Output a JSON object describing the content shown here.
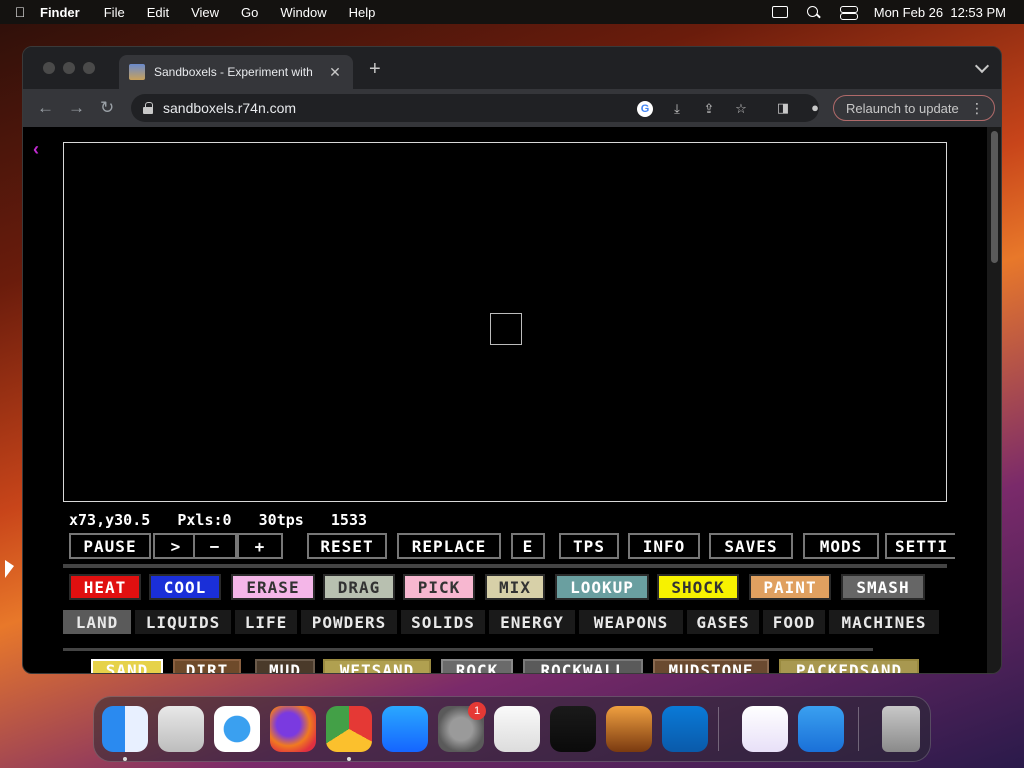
{
  "menubar": {
    "apple": "",
    "items": [
      "Finder",
      "File",
      "Edit",
      "View",
      "Go",
      "Window",
      "Help"
    ],
    "clock": "Mon Feb 26  12:53 PM"
  },
  "browser": {
    "tab_title": "Sandboxels - Experiment with",
    "url": "sandboxels.r74n.com",
    "relaunch": "Relaunch to update"
  },
  "game": {
    "stats": "x73,y30.5   Pxls:0   30tps   1533",
    "toolbar": [
      "Pause",
      ">",
      "−",
      "+",
      "Reset",
      "Replace",
      "E",
      "Tps",
      "Info",
      "Saves",
      "Mods",
      "Setti"
    ],
    "tools": [
      {
        "label": "Heat",
        "bg": "#e01010",
        "fg": "#ffffff"
      },
      {
        "label": "Cool",
        "bg": "#1a2fd8",
        "fg": "#ffffff"
      },
      {
        "label": "Erase",
        "bg": "#f4b6e8",
        "fg": "#333333"
      },
      {
        "label": "Drag",
        "bg": "#b8c0b0",
        "fg": "#333333"
      },
      {
        "label": "Pick",
        "bg": "#f7b7d0",
        "fg": "#333333"
      },
      {
        "label": "Mix",
        "bg": "#d7d0a8",
        "fg": "#333333"
      },
      {
        "label": "Lookup",
        "bg": "#6a9fa0",
        "fg": "#ffffff"
      },
      {
        "label": "Shock",
        "bg": "#f7f200",
        "fg": "#333333"
      },
      {
        "label": "Paint",
        "bg": "#e0a060",
        "fg": "#ffffff"
      },
      {
        "label": "Smash",
        "bg": "#666666",
        "fg": "#ffffff"
      }
    ],
    "categories": [
      "Land",
      "Liquids",
      "Life",
      "Powders",
      "Solids",
      "Energy",
      "Weapons",
      "Gases",
      "Food",
      "Machines"
    ],
    "active_category": "Land",
    "elements": [
      {
        "label": "Sand",
        "bg": "#e6d24a",
        "fg": "#ffffff",
        "border": "#ffffff"
      },
      {
        "label": "Dirt",
        "bg": "#6e4a2a",
        "fg": "#ffffff",
        "border": "#8a6040"
      },
      {
        "label": "Mud",
        "bg": "#4a3a2a",
        "fg": "#ffffff",
        "border": "#6a5a4a"
      },
      {
        "label": "WetSand",
        "bg": "#b0a050",
        "fg": "#ffffff",
        "border": "#9a8a40"
      },
      {
        "label": "Rock",
        "bg": "#6a6a6a",
        "fg": "#ffffff",
        "border": "#8a8a8a"
      },
      {
        "label": "RockWall",
        "bg": "#5a5a5a",
        "fg": "#ffffff",
        "border": "#7a7a7a"
      },
      {
        "label": "Mudstone",
        "bg": "#6a4a30",
        "fg": "#ffffff",
        "border": "#8a6a50"
      },
      {
        "label": "PackedSand",
        "bg": "#a89850",
        "fg": "#ffffff",
        "border": "#9a8a40"
      }
    ]
  },
  "dock": {
    "badge": "1",
    "apps": [
      "Finder",
      "Launchpad",
      "Safari",
      "Firefox",
      "Chrome",
      "App Store",
      "System Settings",
      "TextEdit",
      "Terminal",
      "GarageBand",
      "VS Code",
      "Visual Studio",
      "Weather",
      "Trash"
    ]
  },
  "colors": {
    "accent": "#c02bd0",
    "canvas_border": "#d8d8d8"
  }
}
